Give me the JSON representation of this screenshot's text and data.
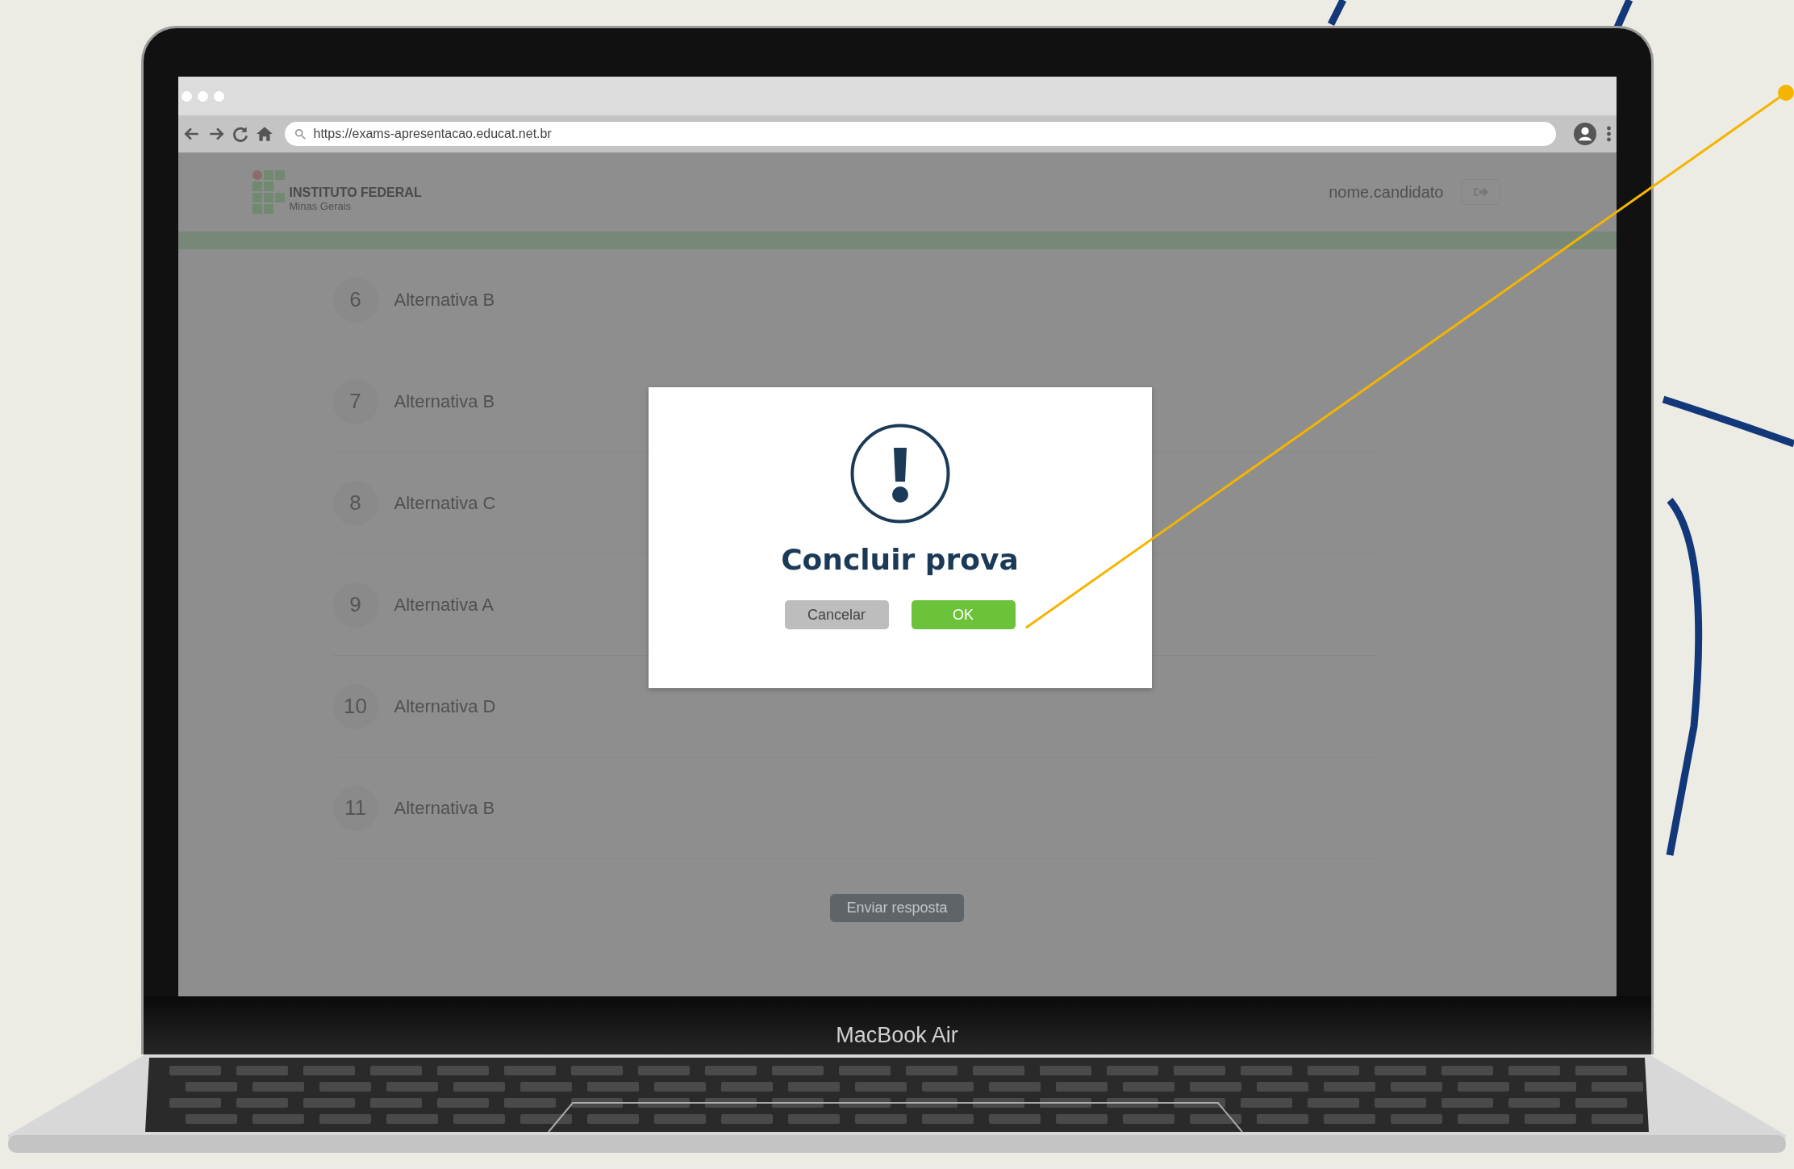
{
  "browser": {
    "url": "https://exams-apresentacao.educat.net.br"
  },
  "header": {
    "logo_title": "INSTITUTO FEDERAL",
    "logo_subtitle": "Minas Gerais",
    "username": "nome.candidato"
  },
  "questions": [
    {
      "number": "6",
      "answer": "Alternativa B"
    },
    {
      "number": "7",
      "answer": "Alternativa B"
    },
    {
      "number": "8",
      "answer": "Alternativa C"
    },
    {
      "number": "9",
      "answer": "Alternativa A"
    },
    {
      "number": "10",
      "answer": "Alternativa D"
    },
    {
      "number": "11",
      "answer": "Alternativa B"
    }
  ],
  "submit_button": "Enviar resposta",
  "dialog": {
    "title": "Concluir prova",
    "buttons": [
      {
        "label": "Cancelar",
        "kind": "cancel"
      },
      {
        "label": "OK",
        "kind": "confirm"
      }
    ]
  },
  "device_label": "MacBook Air"
}
